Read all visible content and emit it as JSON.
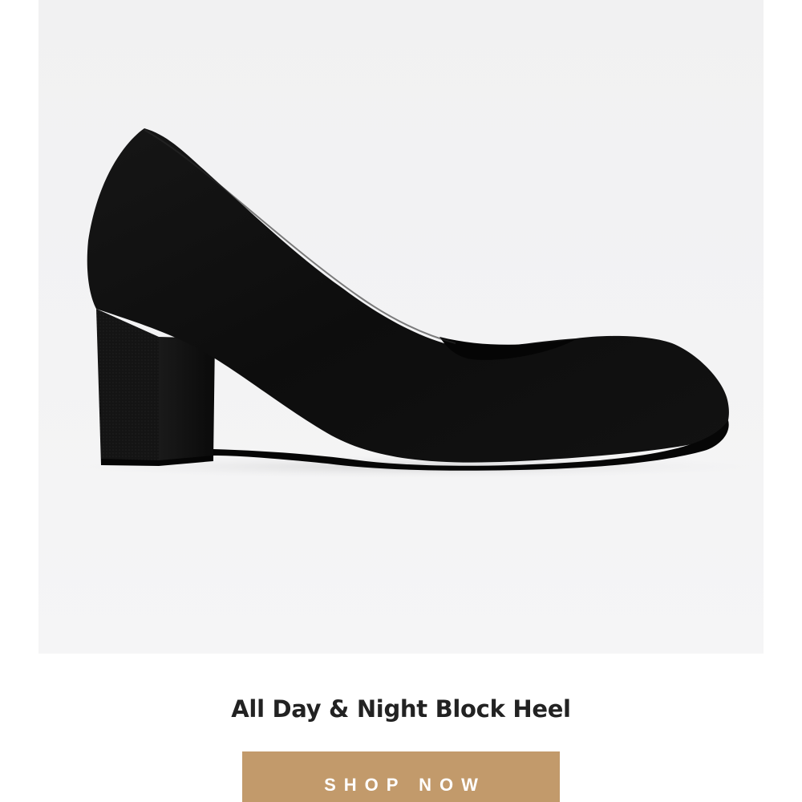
{
  "product": {
    "image_alt": "Black suede block heel pump",
    "title": "All Day & Night Block Heel"
  },
  "cta": {
    "label": "SHOP NOW"
  },
  "colors": {
    "button_background": "#c29a6b",
    "button_text": "#ffffff",
    "title_text": "#222222",
    "photo_background": "#f2f2f3",
    "shoe": "#111111"
  }
}
